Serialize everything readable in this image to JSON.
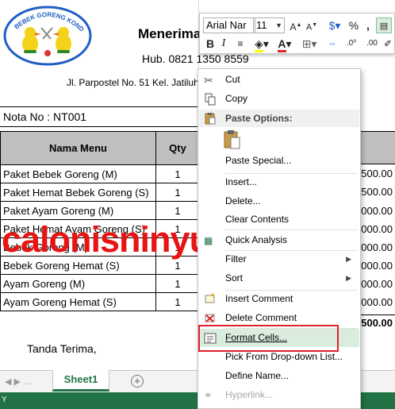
{
  "document": {
    "logo_text": "BEBEK GORENG KONDANG",
    "title": "Menerima",
    "phone": "Hub. 0821 1350 8559",
    "address": "Jl. Parpostel No. 51 Kel. Jatiluh",
    "nota": "Nota No : NT001",
    "signature": "Tanda Terima,"
  },
  "table": {
    "headers": [
      "Nama Menu",
      "Qty"
    ],
    "rows": [
      {
        "menu": "Paket Bebek Goreng (M)",
        "qty": "1",
        "price": "500.00"
      },
      {
        "menu": "Paket Hemat Bebek Goreng (S)",
        "qty": "1",
        "price": "500.00"
      },
      {
        "menu": "Paket Ayam Goreng (M)",
        "qty": "1",
        "price": "000.00"
      },
      {
        "menu": "Paket Hemat Ayam Goreng (S)",
        "qty": "1",
        "price": "000.00"
      },
      {
        "menu": "Bebek Goreng (M)",
        "qty": "1",
        "price": "000.00"
      },
      {
        "menu": "Bebek Goreng Hemat (S)",
        "qty": "1",
        "price": "000.00"
      },
      {
        "menu": "Ayam Goreng (M)",
        "qty": "1",
        "price": "000.00"
      },
      {
        "menu": "Ayam Goreng Hemat (S)",
        "qty": "1",
        "price": "000.00"
      }
    ],
    "total": "500.00"
  },
  "sheet_tabs": {
    "active": "Sheet1",
    "add": "+"
  },
  "mini_toolbar": {
    "font_name": "Arial Nar",
    "font_size": "11",
    "bold": "B",
    "italic": "I",
    "percent": "%",
    "comma": ","
  },
  "context_menu": {
    "cut": "Cut",
    "copy": "Copy",
    "paste_options": "Paste Options:",
    "paste_special": "Paste Special...",
    "insert": "Insert...",
    "delete": "Delete...",
    "clear_contents": "Clear Contents",
    "quick_analysis": "Quick Analysis",
    "filter": "Filter",
    "sort": "Sort",
    "insert_comment": "Insert Comment",
    "delete_comment": "Delete Comment",
    "format_cells": "Format Cells...",
    "pick_dropdown": "Pick From Drop-down List...",
    "define_name": "Define Name...",
    "hyperlink": "Hyperlink..."
  },
  "watermark": "calonisninyure.com",
  "status": "Y",
  "colors": {
    "excel_green": "#217346",
    "highlight": "#d9ecde",
    "frame_red": "#e32027",
    "watermark_red": "#e81414",
    "header_gray": "#bfbfbf"
  }
}
